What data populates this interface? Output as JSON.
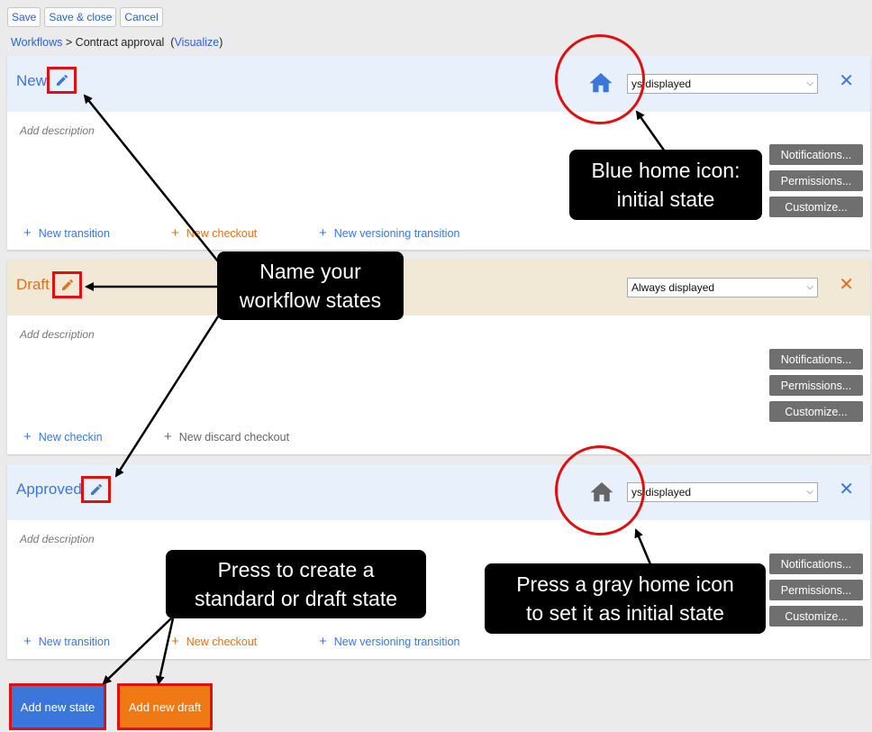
{
  "toolbar": {
    "save": "Save",
    "save_close": "Save & close",
    "cancel": "Cancel"
  },
  "breadcrumb": {
    "root": "Workflows",
    "sep": " > ",
    "current": "Contract approval",
    "open": "  (",
    "visualize": "Visualize",
    "close": ")"
  },
  "states": [
    {
      "name": "New",
      "display": "ys displayed",
      "description_placeholder": "Add description",
      "home_active": true,
      "transitions": [
        "New transition",
        "New checkout",
        "New versioning transition"
      ]
    },
    {
      "name": "Draft",
      "display": "Always displayed",
      "description_placeholder": "Add description",
      "transitions": [
        "New checkin",
        "New discard checkout"
      ]
    },
    {
      "name": "Approved",
      "display": "ys displayed",
      "description_placeholder": "Add description",
      "home_active": false,
      "transitions": [
        "New transition",
        "New checkout",
        "New versioning transition"
      ]
    }
  ],
  "side_buttons": {
    "notifications": "Notifications...",
    "permissions": "Permissions...",
    "customize": "Customize..."
  },
  "actions": {
    "add_state": "Add new state",
    "add_draft": "Add new draft"
  },
  "callouts": {
    "home_initial": [
      "Blue home icon:",
      "initial state"
    ],
    "name_states": [
      "Name your",
      "workflow states"
    ],
    "create_state": [
      "Press to create a",
      "standard or draft state"
    ],
    "gray_home": [
      "Press a gray home icon",
      "to set it as initial state"
    ]
  },
  "colors": {
    "blue": "#3b77db",
    "orange": "#e2711d",
    "red_highlight": "#e01010",
    "gray_home": "#666666"
  },
  "icons": {
    "pencil": "pencil-icon",
    "home": "home-icon",
    "close": "close-icon",
    "plus": "plus-icon",
    "chevron": "chevron-down-icon"
  }
}
